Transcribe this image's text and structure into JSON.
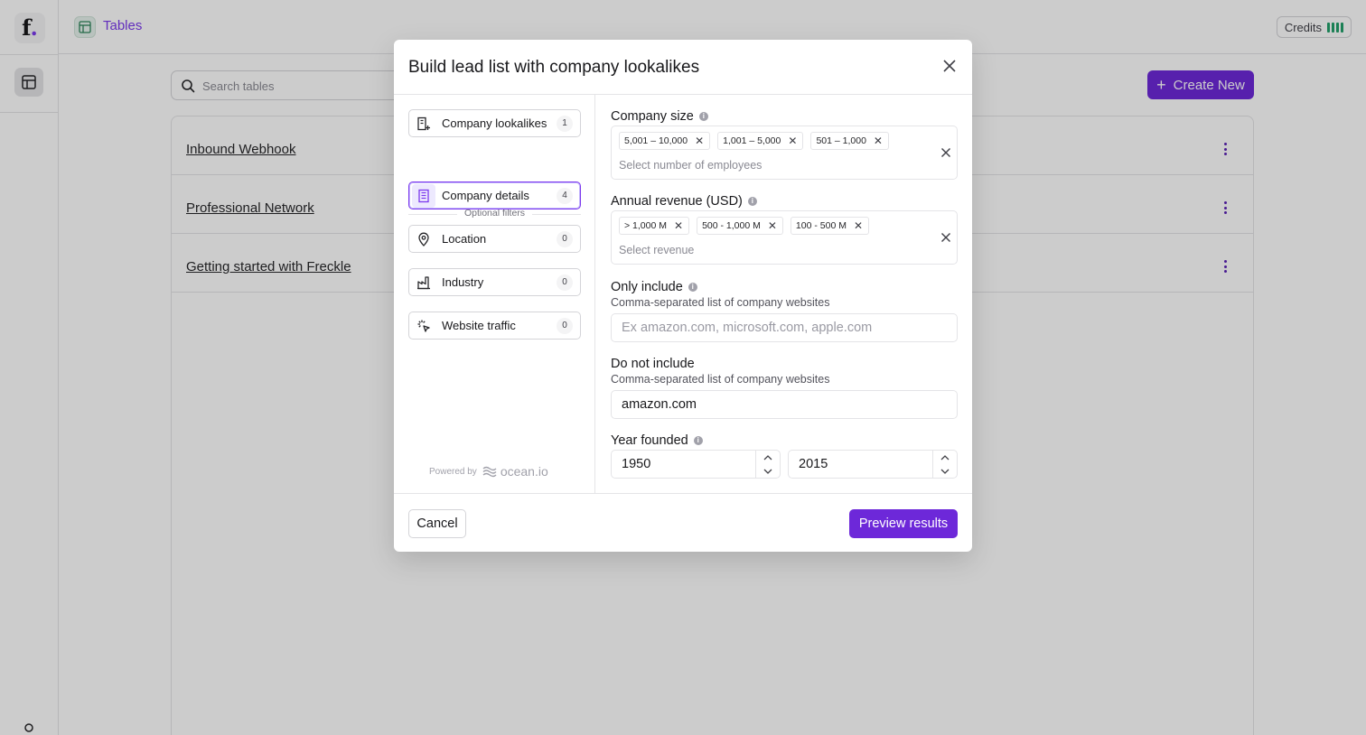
{
  "app": {
    "logo": "f",
    "logo_dot": ".",
    "section_title": "Tables",
    "credits_label": "Credits"
  },
  "toolbar": {
    "search_placeholder": "Search tables",
    "create_label": "Create New"
  },
  "tables": [
    {
      "name": "Inbound Webhook"
    },
    {
      "name": "Professional Network"
    },
    {
      "name": "Getting started with Freckle"
    }
  ],
  "modal": {
    "title": "Build lead list with company lookalikes",
    "nav": {
      "primary": {
        "label": "Company lookalikes",
        "count": "1",
        "icon": "building-plus-icon"
      },
      "separator": "Optional filters",
      "items": [
        {
          "label": "Company details",
          "count": "4",
          "icon": "building-icon",
          "active": true
        },
        {
          "label": "Location",
          "count": "0",
          "icon": "map-pin-icon"
        },
        {
          "label": "Industry",
          "count": "0",
          "icon": "factory-icon"
        },
        {
          "label": "Website traffic",
          "count": "0",
          "icon": "cursor-click-icon"
        }
      ]
    },
    "powered_by": "Powered by",
    "powered_brand": "ocean.io",
    "company_size": {
      "label": "Company size",
      "chips": [
        "5,001 – 10,000",
        "1,001 – 5,000",
        "501 – 1,000"
      ],
      "placeholder": "Select number of employees"
    },
    "annual_revenue": {
      "label": "Annual revenue (USD)",
      "chips": [
        "> 1,000 M",
        "500 - 1,000 M",
        "100 - 500 M"
      ],
      "placeholder": "Select revenue"
    },
    "only_include": {
      "label": "Only include",
      "help": "Comma-separated list of company websites",
      "placeholder": "Ex amazon.com, microsoft.com, apple.com",
      "value": ""
    },
    "do_not_include": {
      "label": "Do not include",
      "help": "Comma-separated list of company websites",
      "value": "amazon.com"
    },
    "year_founded": {
      "label": "Year founded",
      "from": "1950",
      "to": "2015"
    },
    "cancel_label": "Cancel",
    "preview_label": "Preview results"
  },
  "colors": {
    "accent": "#6d28d9",
    "credits_bar": "#22a06b"
  }
}
